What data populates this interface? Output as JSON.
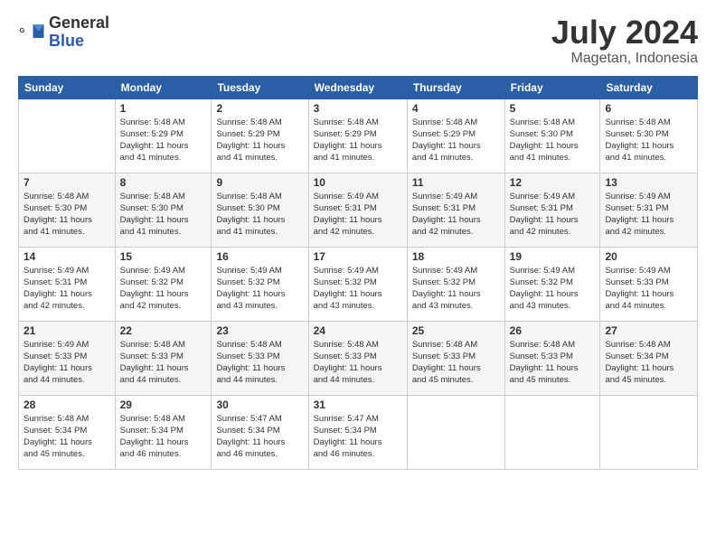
{
  "logo": {
    "general": "General",
    "blue": "Blue"
  },
  "header": {
    "month_year": "July 2024",
    "location": "Magetan, Indonesia"
  },
  "weekdays": [
    "Sunday",
    "Monday",
    "Tuesday",
    "Wednesday",
    "Thursday",
    "Friday",
    "Saturday"
  ],
  "weeks": [
    [
      {
        "day": "",
        "info": ""
      },
      {
        "day": "1",
        "info": "Sunrise: 5:48 AM\nSunset: 5:29 PM\nDaylight: 11 hours\nand 41 minutes."
      },
      {
        "day": "2",
        "info": "Sunrise: 5:48 AM\nSunset: 5:29 PM\nDaylight: 11 hours\nand 41 minutes."
      },
      {
        "day": "3",
        "info": "Sunrise: 5:48 AM\nSunset: 5:29 PM\nDaylight: 11 hours\nand 41 minutes."
      },
      {
        "day": "4",
        "info": "Sunrise: 5:48 AM\nSunset: 5:29 PM\nDaylight: 11 hours\nand 41 minutes."
      },
      {
        "day": "5",
        "info": "Sunrise: 5:48 AM\nSunset: 5:30 PM\nDaylight: 11 hours\nand 41 minutes."
      },
      {
        "day": "6",
        "info": "Sunrise: 5:48 AM\nSunset: 5:30 PM\nDaylight: 11 hours\nand 41 minutes."
      }
    ],
    [
      {
        "day": "7",
        "info": "Sunrise: 5:48 AM\nSunset: 5:30 PM\nDaylight: 11 hours\nand 41 minutes."
      },
      {
        "day": "8",
        "info": "Sunrise: 5:48 AM\nSunset: 5:30 PM\nDaylight: 11 hours\nand 41 minutes."
      },
      {
        "day": "9",
        "info": "Sunrise: 5:48 AM\nSunset: 5:30 PM\nDaylight: 11 hours\nand 41 minutes."
      },
      {
        "day": "10",
        "info": "Sunrise: 5:49 AM\nSunset: 5:31 PM\nDaylight: 11 hours\nand 42 minutes."
      },
      {
        "day": "11",
        "info": "Sunrise: 5:49 AM\nSunset: 5:31 PM\nDaylight: 11 hours\nand 42 minutes."
      },
      {
        "day": "12",
        "info": "Sunrise: 5:49 AM\nSunset: 5:31 PM\nDaylight: 11 hours\nand 42 minutes."
      },
      {
        "day": "13",
        "info": "Sunrise: 5:49 AM\nSunset: 5:31 PM\nDaylight: 11 hours\nand 42 minutes."
      }
    ],
    [
      {
        "day": "14",
        "info": "Sunrise: 5:49 AM\nSunset: 5:31 PM\nDaylight: 11 hours\nand 42 minutes."
      },
      {
        "day": "15",
        "info": "Sunrise: 5:49 AM\nSunset: 5:32 PM\nDaylight: 11 hours\nand 42 minutes."
      },
      {
        "day": "16",
        "info": "Sunrise: 5:49 AM\nSunset: 5:32 PM\nDaylight: 11 hours\nand 43 minutes."
      },
      {
        "day": "17",
        "info": "Sunrise: 5:49 AM\nSunset: 5:32 PM\nDaylight: 11 hours\nand 43 minutes."
      },
      {
        "day": "18",
        "info": "Sunrise: 5:49 AM\nSunset: 5:32 PM\nDaylight: 11 hours\nand 43 minutes."
      },
      {
        "day": "19",
        "info": "Sunrise: 5:49 AM\nSunset: 5:32 PM\nDaylight: 11 hours\nand 43 minutes."
      },
      {
        "day": "20",
        "info": "Sunrise: 5:49 AM\nSunset: 5:33 PM\nDaylight: 11 hours\nand 44 minutes."
      }
    ],
    [
      {
        "day": "21",
        "info": "Sunrise: 5:49 AM\nSunset: 5:33 PM\nDaylight: 11 hours\nand 44 minutes."
      },
      {
        "day": "22",
        "info": "Sunrise: 5:48 AM\nSunset: 5:33 PM\nDaylight: 11 hours\nand 44 minutes."
      },
      {
        "day": "23",
        "info": "Sunrise: 5:48 AM\nSunset: 5:33 PM\nDaylight: 11 hours\nand 44 minutes."
      },
      {
        "day": "24",
        "info": "Sunrise: 5:48 AM\nSunset: 5:33 PM\nDaylight: 11 hours\nand 44 minutes."
      },
      {
        "day": "25",
        "info": "Sunrise: 5:48 AM\nSunset: 5:33 PM\nDaylight: 11 hours\nand 45 minutes."
      },
      {
        "day": "26",
        "info": "Sunrise: 5:48 AM\nSunset: 5:33 PM\nDaylight: 11 hours\nand 45 minutes."
      },
      {
        "day": "27",
        "info": "Sunrise: 5:48 AM\nSunset: 5:34 PM\nDaylight: 11 hours\nand 45 minutes."
      }
    ],
    [
      {
        "day": "28",
        "info": "Sunrise: 5:48 AM\nSunset: 5:34 PM\nDaylight: 11 hours\nand 45 minutes."
      },
      {
        "day": "29",
        "info": "Sunrise: 5:48 AM\nSunset: 5:34 PM\nDaylight: 11 hours\nand 46 minutes."
      },
      {
        "day": "30",
        "info": "Sunrise: 5:47 AM\nSunset: 5:34 PM\nDaylight: 11 hours\nand 46 minutes."
      },
      {
        "day": "31",
        "info": "Sunrise: 5:47 AM\nSunset: 5:34 PM\nDaylight: 11 hours\nand 46 minutes."
      },
      {
        "day": "",
        "info": ""
      },
      {
        "day": "",
        "info": ""
      },
      {
        "day": "",
        "info": ""
      }
    ]
  ]
}
